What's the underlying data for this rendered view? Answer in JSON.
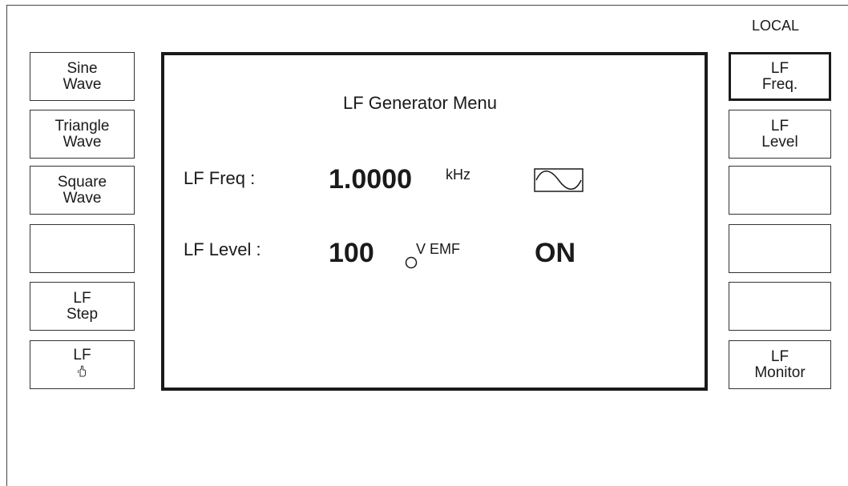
{
  "header": {
    "local_label": "LOCAL"
  },
  "softkeys_left": [
    {
      "line1": "Sine",
      "line2": "Wave"
    },
    {
      "line1": "Triangle",
      "line2": "Wave"
    },
    {
      "line1": "Square",
      "line2": "Wave"
    },
    {
      "line1": "",
      "line2": ""
    },
    {
      "line1": "LF",
      "line2": "Step"
    },
    {
      "line1": "LF",
      "line2": ""
    }
  ],
  "softkeys_right": [
    {
      "line1": "LF",
      "line2": "Freq.",
      "active": true
    },
    {
      "line1": "LF",
      "line2": "Level"
    },
    {
      "line1": "",
      "line2": ""
    },
    {
      "line1": "",
      "line2": ""
    },
    {
      "line1": "",
      "line2": ""
    },
    {
      "line1": "LF",
      "line2": "Monitor"
    }
  ],
  "screen": {
    "title": "LF Generator Menu",
    "freq": {
      "label": "LF Freq :",
      "value": "1.0000",
      "unit": "kHz",
      "waveform_icon": "sine-wave-icon"
    },
    "level": {
      "label": "LF Level :",
      "value": "100",
      "unit": "V EMF",
      "state": "ON"
    }
  }
}
